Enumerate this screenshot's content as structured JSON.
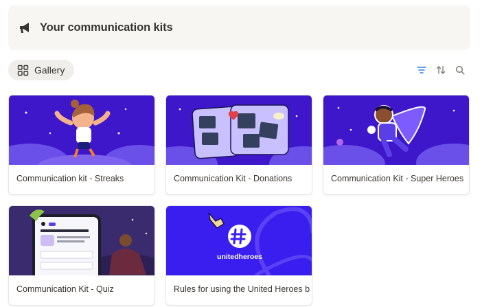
{
  "header": {
    "title": "Your communication kits",
    "icon": "megaphone-icon"
  },
  "toolbar": {
    "view_label": "Gallery",
    "view_icon": "gallery-grid-icon",
    "filter_icon": "filter-icon",
    "sort_icon": "sort-icon",
    "search_icon": "search-icon"
  },
  "colors": {
    "accent": "#2f80ed",
    "cover_purple": "#3d17c9",
    "brand_blue": "#3a1ef0"
  },
  "cards": [
    {
      "caption": "Communication kit - Streaks"
    },
    {
      "caption": "Communication Kit - Donations"
    },
    {
      "caption": "Communication Kit - Super Heroes"
    },
    {
      "caption": "Communication Kit - Quiz"
    },
    {
      "caption": "Rules for using the United Heroes b",
      "cover_text": "unitedheroes"
    }
  ]
}
